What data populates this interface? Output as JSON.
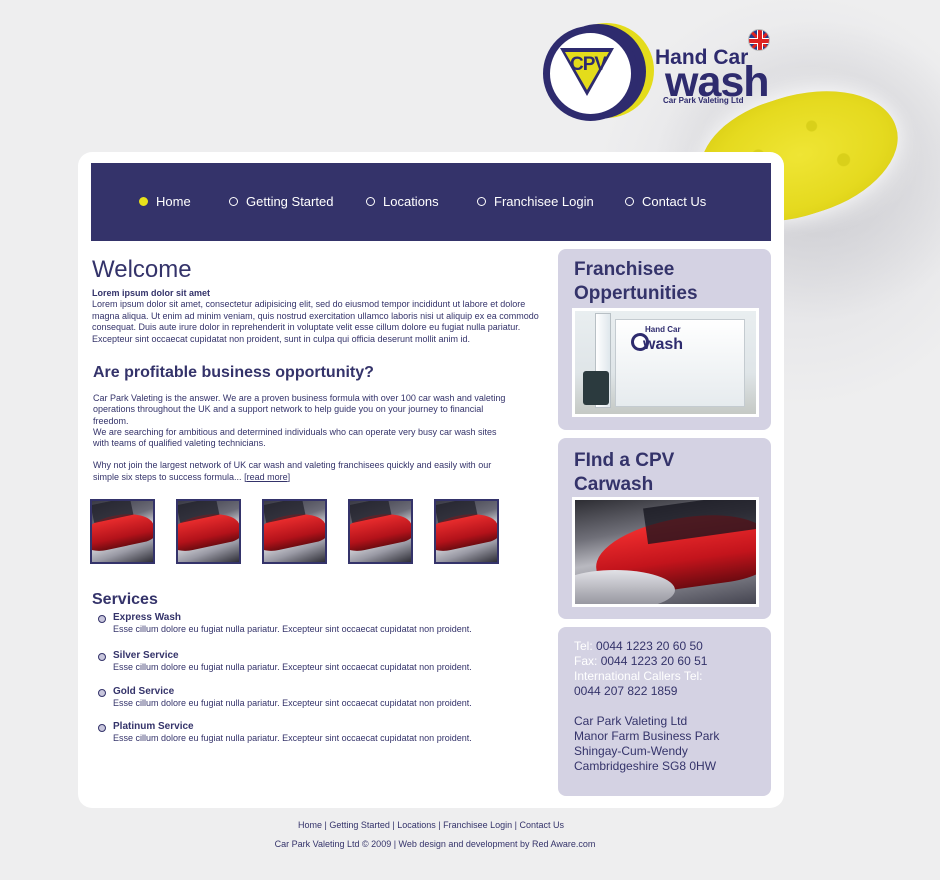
{
  "colors": {
    "navy": "#34336a",
    "yellow": "#e8e21a",
    "sidebar": "#d4d2e3"
  },
  "logo": {
    "mark": "CPV",
    "line1": "Hand Car",
    "line2": "wash",
    "subline": "Car Park Valeting Ltd",
    "language_flag_icon": "uk-flag-icon"
  },
  "nav": {
    "items": [
      {
        "label": "Home",
        "active": true
      },
      {
        "label": "Getting Started",
        "active": false
      },
      {
        "label": "Locations",
        "active": false
      },
      {
        "label": "Franchisee Login",
        "active": false
      },
      {
        "label": "Contact Us",
        "active": false
      }
    ]
  },
  "welcome": {
    "title": "Welcome",
    "subtitle": "Lorem ipsum dolor sit amet",
    "body": "Lorem ipsum dolor sit amet, consectetur adipisicing elit, sed do eiusmod tempor incididunt ut labore et dolore magna aliqua. Ut enim ad minim veniam, quis nostrud exercitation ullamco laboris nisi ut aliquip ex ea commodo consequat. Duis aute irure dolor in reprehenderit in voluptate velit esse cillum dolore eu fugiat nulla pariatur. Excepteur sint occaecat cupidatat non proident, sunt in culpa qui officia deserunt mollit anim id."
  },
  "opportunity": {
    "title": "Are profitable business opportunity?",
    "para1": "Car Park Valeting is the answer. We are a proven business formula with over 100 car wash and valeting operations throughout the UK and a support network to help guide you on your journey to financial freedom.",
    "para2": "We are searching for ambitious and determined individuals who can operate very busy car wash sites with teams of qualified valeting technicians.",
    "para3": "Why not join the largest network of UK car wash and valeting franchisees quickly and easily with our simple six steps to success formula...",
    "read_more": "[read more]"
  },
  "thumbnails": [
    "car-photo",
    "car-photo",
    "car-photo",
    "car-photo",
    "car-photo"
  ],
  "services": {
    "title": "Services",
    "items": [
      {
        "name": "Express Wash",
        "desc": "Esse cillum dolore eu fugiat nulla pariatur. Excepteur sint occaecat cupidatat non proident."
      },
      {
        "name": "Silver Service",
        "desc": "Esse cillum dolore eu fugiat nulla pariatur. Excepteur sint occaecat cupidatat non proident."
      },
      {
        "name": "Gold Service",
        "desc": "Esse cillum dolore eu fugiat nulla pariatur. Excepteur sint occaecat cupidatat non proident."
      },
      {
        "name": "Platinum Service",
        "desc": "Esse cillum dolore eu fugiat nulla pariatur. Excepteur sint occaecat cupidatat non proident."
      }
    ]
  },
  "sidebar": {
    "franchisee": {
      "title_line1": "Franchisee",
      "title_line2": "Oppertunities",
      "trailer_logo_line1": "Hand Car",
      "trailer_logo_line2": "wash"
    },
    "find": {
      "title_line1": "FInd a CPV",
      "title_line2": "Carwash"
    },
    "contact": {
      "tel_label": "Tel:",
      "tel": "0044 1223 20 60 50",
      "fax_label": "Fax:",
      "fax": "0044 1223 20 60 51",
      "intl_label": "International Callers Tel:",
      "intl": "0044 207 822 1859",
      "address": [
        "Car Park Valeting Ltd",
        "Manor Farm Business Park",
        "Shingay-Cum-Wendy",
        "Cambridgeshire SG8 0HW"
      ]
    }
  },
  "footer": {
    "links": [
      "Home",
      "Getting Started",
      "Locations",
      "Franchisee Login",
      "Contact Us"
    ],
    "separator": " | ",
    "copyright": "Car Park Valeting Ltd © 2009 | Web design and development by Red Aware.com"
  }
}
